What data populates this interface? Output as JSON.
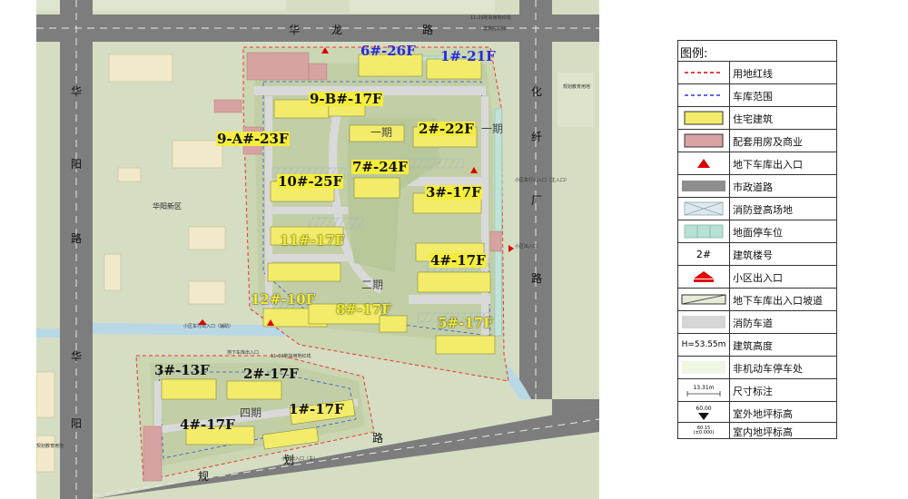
{
  "buildings": [
    {
      "id": "b6",
      "label": "6#-26F",
      "style": "blue"
    },
    {
      "id": "b1n",
      "label": "1#-21F",
      "style": "blue"
    },
    {
      "id": "b9b",
      "label": "9-B#-17F",
      "style": "bg"
    },
    {
      "id": "b9a",
      "label": "9-A#-23F",
      "style": "bg"
    },
    {
      "id": "b2",
      "label": "2#-22F",
      "style": "bg"
    },
    {
      "id": "b7",
      "label": "7#-24F",
      "style": "bg"
    },
    {
      "id": "b10",
      "label": "10#-25F",
      "style": "bg"
    },
    {
      "id": "b3",
      "label": "3#-17F",
      "style": "bg"
    },
    {
      "id": "b11",
      "label": "11#-17F",
      "style": "yel"
    },
    {
      "id": "b4",
      "label": "4#-17F",
      "style": "bg"
    },
    {
      "id": "b12",
      "label": "12#-10F",
      "style": "yel"
    },
    {
      "id": "b8",
      "label": "8#-17F",
      "style": "yel"
    },
    {
      "id": "b5",
      "label": "5#-17F",
      "style": "yel"
    },
    {
      "id": "s3",
      "label": "3#-13F",
      "style": "black"
    },
    {
      "id": "s2",
      "label": "2#-17F",
      "style": "black"
    },
    {
      "id": "s4",
      "label": "4#-17F",
      "style": "black"
    },
    {
      "id": "s1",
      "label": "1#-17F",
      "style": "black"
    }
  ],
  "roads": {
    "north": [
      "华",
      "龙",
      "路"
    ],
    "west": [
      "华",
      "阳",
      "路",
      "华",
      "阳"
    ],
    "east": [
      "化",
      "纤",
      "厂",
      "路"
    ],
    "south": [
      "规",
      "划",
      "路"
    ]
  },
  "phases": [
    "一期",
    "一期",
    "二期",
    "四期"
  ],
  "district": "华阳新区",
  "map_notes": {
    "north_entrance": "11-29地块用地红线",
    "note2": "建筑控制线",
    "right_top": "规划教育用地",
    "entrance_w": "小区车行出入口（辅助）",
    "entrance_e": "小区出入口",
    "entrance_e2": "小区车行出入口（主入口）",
    "garage_s": "地下车库出入口",
    "bottom_left": "规划教育用地",
    "south_gate": "小区出入口（主）",
    "south_note": "11-30地块用地红线"
  },
  "legend": {
    "title": "图例:",
    "items": [
      {
        "label": "用地红线",
        "symbol": "red-dashed-line"
      },
      {
        "label": "车库范围",
        "symbol": "blue-dashed-line"
      },
      {
        "label": "住宅建筑",
        "symbol": "yellow-box",
        "color": "#f2ec6a"
      },
      {
        "label": "配套用房及商业",
        "symbol": "pink-box",
        "color": "#d9a3a3"
      },
      {
        "label": "地下车库出入口",
        "symbol": "red-triangle",
        "color": "#e00000"
      },
      {
        "label": "市政道路",
        "symbol": "gray-bar",
        "color": "#8e8e8e"
      },
      {
        "label": "消防登高场地",
        "symbol": "hatched-box"
      },
      {
        "label": "地面停车位",
        "symbol": "parking-box",
        "color": "#b8e0d6"
      },
      {
        "label": "建筑楼号",
        "symbol": "text",
        "text": "2#"
      },
      {
        "label": "小区出入口",
        "symbol": "red-entrance",
        "color": "#e00000"
      },
      {
        "label": "地下车库出入口坡道",
        "symbol": "ramp"
      },
      {
        "label": "消防车道",
        "symbol": "light-gray-box",
        "color": "#d6d6d6"
      },
      {
        "label": "建筑高度",
        "symbol": "text",
        "text": "H=53.55m"
      },
      {
        "label": "非机动车停车处",
        "symbol": "light-green-box",
        "color": "#eef6e4"
      },
      {
        "label": "尺寸标注",
        "symbol": "dimension",
        "text": "13.31m"
      },
      {
        "label": "室外地坪标高",
        "symbol": "elev-outdoor",
        "text": "60.00"
      },
      {
        "label": "室内地坪标高",
        "symbol": "elev-indoor",
        "text": "60.15",
        "subtext": "(±0.000)"
      }
    ]
  }
}
